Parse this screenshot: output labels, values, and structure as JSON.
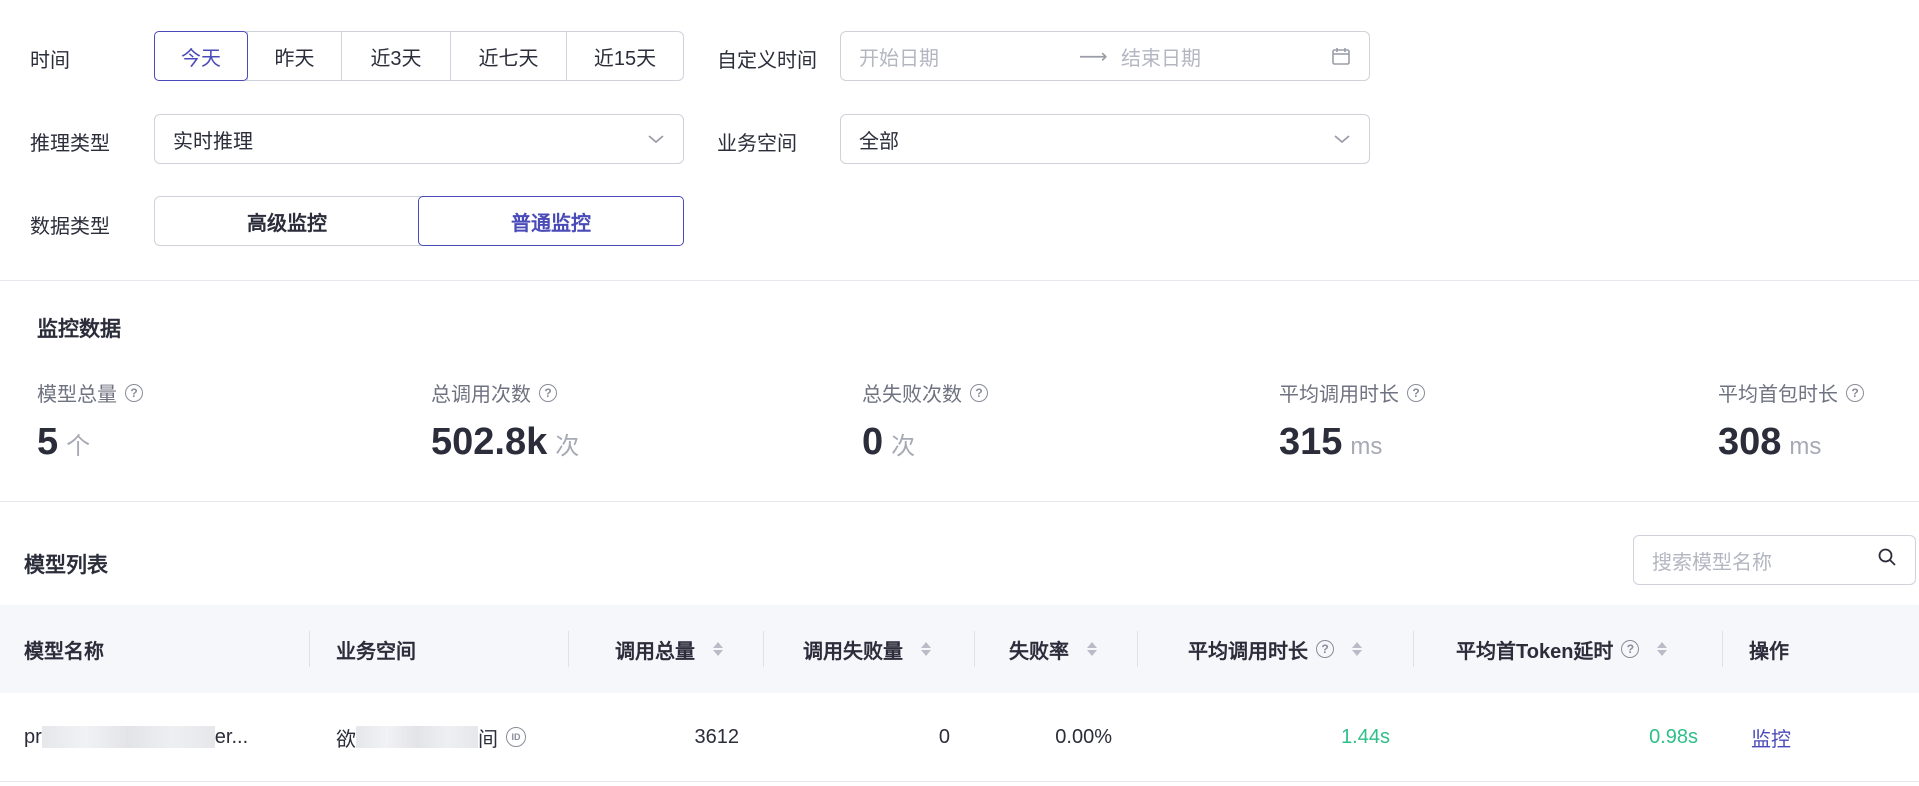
{
  "filters": {
    "time_label": "时间",
    "time_options": [
      "今天",
      "昨天",
      "近3天",
      "近七天",
      "近15天"
    ],
    "time_selected": 0,
    "custom_time_label": "自定义时间",
    "start_placeholder": "开始日期",
    "end_placeholder": "结束日期",
    "inference_type_label": "推理类型",
    "inference_type_value": "实时推理",
    "workspace_label": "业务空间",
    "workspace_value": "全部",
    "data_type_label": "数据类型",
    "data_type_options": [
      "高级监控",
      "普通监控"
    ],
    "data_type_selected": 1
  },
  "monitor": {
    "title": "监控数据",
    "stats": [
      {
        "label": "模型总量",
        "value": "5",
        "unit": "个"
      },
      {
        "label": "总调用次数",
        "value": "502.8k",
        "unit": "次"
      },
      {
        "label": "总失败次数",
        "value": "0",
        "unit": "次"
      },
      {
        "label": "平均调用时长",
        "value": "315",
        "unit": "ms"
      },
      {
        "label": "平均首包时长",
        "value": "308",
        "unit": "ms"
      }
    ]
  },
  "model_list": {
    "title": "模型列表",
    "search_placeholder": "搜索模型名称",
    "columns": [
      "模型名称",
      "业务空间",
      "调用总量",
      "调用失败量",
      "失败率",
      "平均调用时长",
      "平均首Token延时",
      "操作"
    ],
    "rows": [
      {
        "name_prefix": "pr",
        "name_suffix": "er...",
        "workspace_prefix": "欲",
        "workspace_suffix": "间",
        "total": "3612",
        "failed": "0",
        "fail_rate": "0.00%",
        "avg_duration": "1.44s",
        "avg_first_token": "0.98s",
        "action": "监控"
      }
    ]
  },
  "icons": {
    "arrow": "arrow-right-icon",
    "calendar": "calendar-icon",
    "chevron": "chevron-down-icon",
    "help": "question-circle-icon",
    "search": "search-icon",
    "id": "id-badge-icon"
  },
  "colors": {
    "accent": "#4a4bb8",
    "success": "#2fbf8a"
  }
}
